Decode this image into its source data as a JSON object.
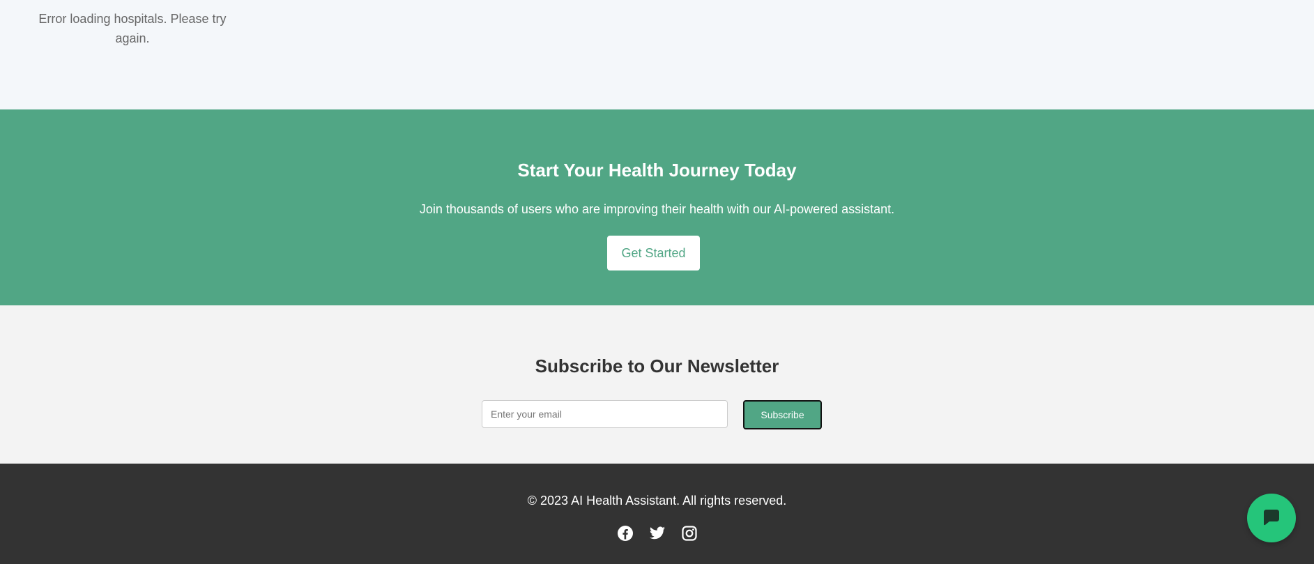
{
  "hospitals": {
    "error_message": "Error loading hospitals. Please try again."
  },
  "cta": {
    "title": "Start Your Health Journey Today",
    "text": "Join thousands of users who are improving their health with our AI-powered assistant.",
    "button_label": "Get Started"
  },
  "newsletter": {
    "title": "Subscribe to Our Newsletter",
    "email_placeholder": "Enter your email",
    "email_value": "",
    "subscribe_label": "Subscribe"
  },
  "footer": {
    "copyright": "© 2023 AI Health Assistant. All rights reserved.",
    "social": [
      {
        "icon": "facebook-icon"
      },
      {
        "icon": "twitter-icon"
      },
      {
        "icon": "instagram-icon"
      }
    ]
  },
  "chat": {
    "icon": "chat-icon"
  },
  "colors": {
    "brand_green": "#51a685",
    "chat_green": "#25c57a",
    "footer_bg": "#333333",
    "newsletter_bg": "#f3f3f3",
    "page_bg": "#f4f7fa"
  }
}
